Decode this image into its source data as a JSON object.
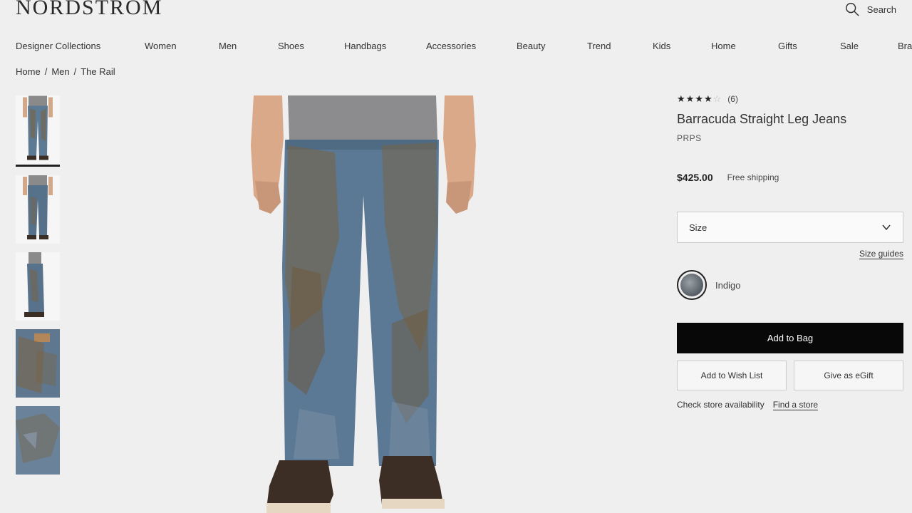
{
  "header": {
    "logo": "NORDSTROM",
    "search_label": "Search",
    "search_icon": "search-icon"
  },
  "nav": [
    "Designer Collections",
    "Women",
    "Men",
    "Shoes",
    "Handbags",
    "Accessories",
    "Beauty",
    "Trend",
    "Kids",
    "Home",
    "Gifts",
    "Sale",
    "Bra"
  ],
  "breadcrumb": {
    "items": [
      "Home",
      "Men",
      "The Rail"
    ],
    "separator": "/"
  },
  "product": {
    "rating_stars": 4,
    "rating_max": 5,
    "review_count": "(6)",
    "title": "Barracuda Straight Leg Jeans",
    "brand": "PRPS",
    "price": "$425.00",
    "shipping": "Free shipping",
    "size_label": "Size",
    "size_guides": "Size guides",
    "color_name": "Indigo",
    "add_to_bag": "Add to Bag",
    "wish_list": "Add to Wish List",
    "egift": "Give as eGift",
    "store_availability": "Check store availability",
    "find_store": "Find a store"
  },
  "colors": {
    "background": "#efefef",
    "primary_button": "#080808",
    "denim": "#5d7a94",
    "mud": "#7a6240"
  }
}
